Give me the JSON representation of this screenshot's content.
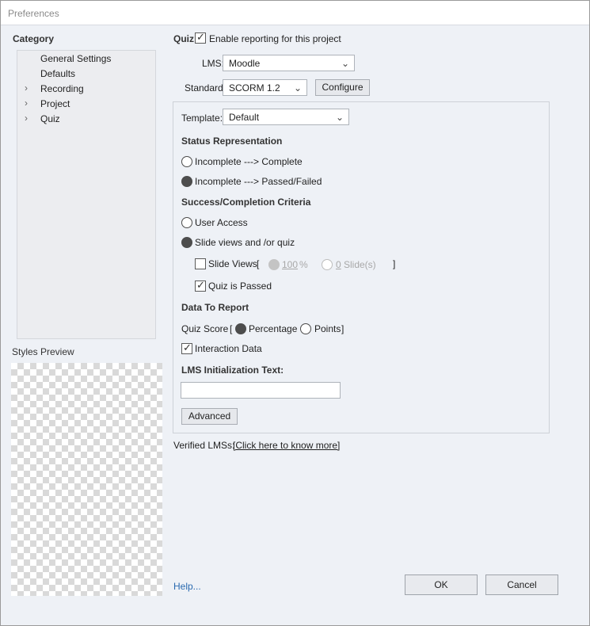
{
  "window": {
    "title": "Preferences"
  },
  "category": {
    "heading": "Category",
    "items": [
      {
        "label": "General Settings",
        "expandable": false
      },
      {
        "label": "Defaults",
        "expandable": false
      },
      {
        "label": "Recording",
        "expandable": true
      },
      {
        "label": "Project",
        "expandable": true
      },
      {
        "label": "Quiz",
        "expandable": true
      }
    ]
  },
  "styles_preview": {
    "heading": "Styles Preview"
  },
  "quiz": {
    "label": "Quiz:",
    "enable_reporting": {
      "label": "Enable reporting for this project",
      "checked": true
    }
  },
  "lms": {
    "label": "LMS:",
    "value": "Moodle"
  },
  "standard": {
    "label": "Standard:",
    "value": "SCORM 1.2",
    "configure_label": "Configure"
  },
  "template": {
    "label": "Template:",
    "value": "Default"
  },
  "status_representation": {
    "heading": "Status Representation",
    "options": [
      {
        "label": "Incomplete ---> Complete",
        "selected": false
      },
      {
        "label": "Incomplete ---> Passed/Failed",
        "selected": true
      }
    ]
  },
  "criteria": {
    "heading": "Success/Completion Criteria",
    "user_access": {
      "label": "User Access",
      "selected": false
    },
    "slide_views_quiz": {
      "label": "Slide views and /or quiz",
      "selected": true
    },
    "slide_views": {
      "label": "Slide Views",
      "checked": false,
      "open_bracket": "[",
      "close_bracket": "]",
      "percent_value": "100",
      "percent_unit": "%",
      "slides_value": "0",
      "slides_unit": "Slide(s)"
    },
    "quiz_passed": {
      "label": "Quiz is Passed",
      "checked": true
    }
  },
  "data_to_report": {
    "heading": "Data To Report",
    "quiz_score_label": "Quiz Score",
    "open_bracket": "[",
    "close_bracket": "]",
    "percentage": {
      "label": "Percentage",
      "selected": true
    },
    "points": {
      "label": "Points",
      "selected": false
    },
    "interaction_data": {
      "label": "Interaction Data",
      "checked": true
    }
  },
  "lms_init": {
    "label": "LMS Initialization Text:",
    "value": ""
  },
  "advanced_label": "Advanced",
  "verified": {
    "label": "Verified LMSs:",
    "link": "[Click here to know more]"
  },
  "footer": {
    "help": "Help...",
    "ok": "OK",
    "cancel": "Cancel"
  }
}
